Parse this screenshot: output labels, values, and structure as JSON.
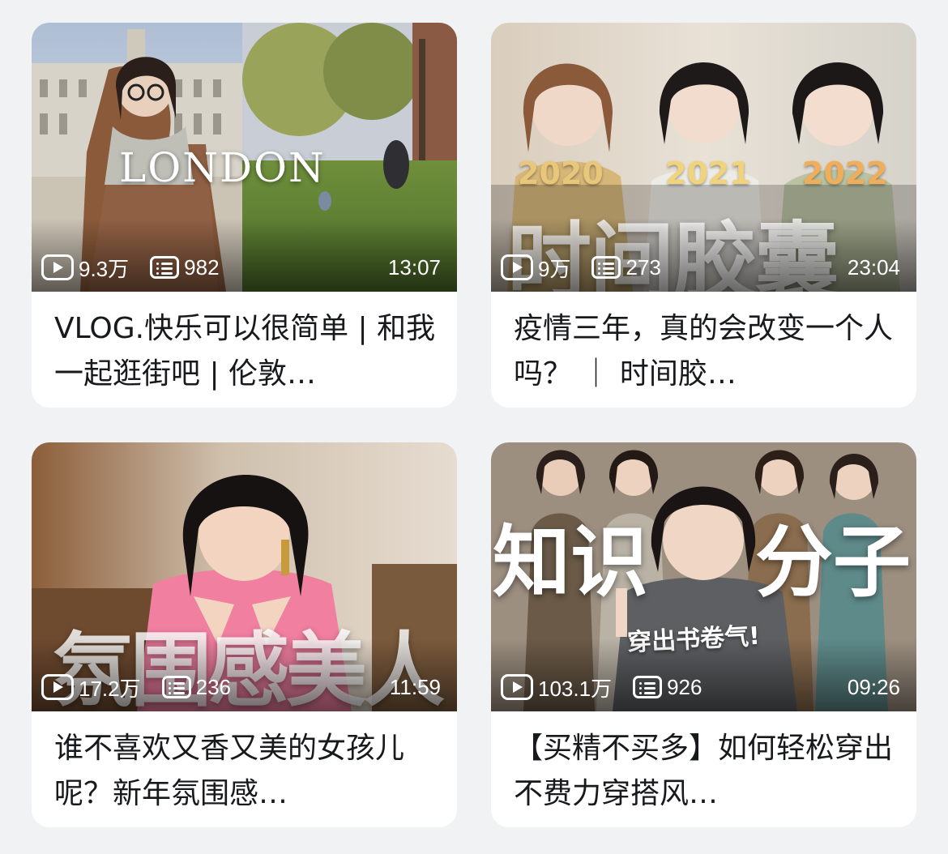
{
  "videos": [
    {
      "thumb_caption": "LONDON",
      "views": "9.3万",
      "danmaku": "982",
      "duration": "13:07",
      "title": "VLOG.快乐可以很简单 | 和我一起逛街吧 | 伦敦…"
    },
    {
      "thumb_caption": "时间胶囊",
      "thumb_years": [
        "2020",
        "2021",
        "2022"
      ],
      "views": "9万",
      "danmaku": "273",
      "duration": "23:04",
      "title": "疫情三年，真的会改变一个人吗？ ｜ 时间胶…"
    },
    {
      "thumb_caption": "氛围感美人",
      "views": "17.2万",
      "danmaku": "236",
      "duration": "11:59",
      "title": "谁不喜欢又香又美的女孩儿呢？新年氛围感…"
    },
    {
      "thumb_caption": "知识",
      "thumb_caption_2": "分子",
      "thumb_caption_3": "穿出书卷气!",
      "views": "103.1万",
      "danmaku": "926",
      "duration": "09:26",
      "title": "【买精不买多】如何轻松穿出不费力穿搭风…"
    }
  ],
  "icons": {
    "views": "play-count-icon",
    "danmaku": "danmaku-count-icon"
  },
  "colors": {
    "background": "#f1f2f4",
    "card": "#ffffff",
    "title_text": "#18191c"
  }
}
